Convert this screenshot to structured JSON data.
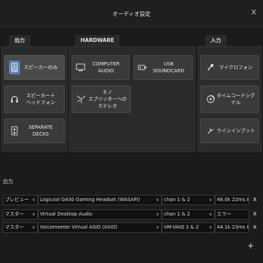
{
  "window": {
    "title": "オーディオ設定",
    "close_label": "X"
  },
  "tabs": {
    "output": "出力",
    "hardware": "HARDWARE",
    "input": "入力"
  },
  "output_buttons": [
    {
      "label": "スピーカーのみ",
      "icon": "speaker-icon",
      "active": true
    },
    {
      "label": "スピーカー＋\nヘッドフォン",
      "icon": "headphones-icon",
      "active": false
    },
    {
      "label": "SEPARATE DECKS",
      "icon": "decks-icon",
      "active": false
    }
  ],
  "hardware_buttons": [
    {
      "label": "COMPUTER AUDIO",
      "icon": "monitor-icon"
    },
    {
      "label": "USB SOUNDCARD",
      "icon": "usb-soundcard-icon"
    },
    {
      "label": "モノ\nスプリッターへのステレオ",
      "icon": "splitter-icon"
    }
  ],
  "input_buttons": [
    {
      "label": "マイクロフォン",
      "icon": "microphone-icon"
    },
    {
      "label": "タイムコードシグナル",
      "icon": "timecode-icon"
    },
    {
      "label": "ラインインプット",
      "icon": "line-input-icon"
    }
  ],
  "routing": {
    "section_label": "出力",
    "rows": [
      {
        "role": "プレビュー",
        "device": "Logicool G430 Gaming Headset (WASAPI)",
        "channel": "chan 1 & 2",
        "status": "48.0k 22ms 8o"
      },
      {
        "role": "マスター",
        "device": "Virtual Desktop Audio",
        "channel": "chan 1 & 2",
        "status": "エラー"
      },
      {
        "role": "マスター",
        "device": "Voicemeeter Virtual ASIO (ASIO)",
        "channel": "VM-VAIO 1 & 2",
        "status": "44.1k 23ms 8o/8i"
      }
    ],
    "remove_label": "x",
    "add_label": "+"
  },
  "colors": {
    "accent": "#5b7fb4",
    "background": "#1b1b1b",
    "panel": "#2a2a2a"
  }
}
